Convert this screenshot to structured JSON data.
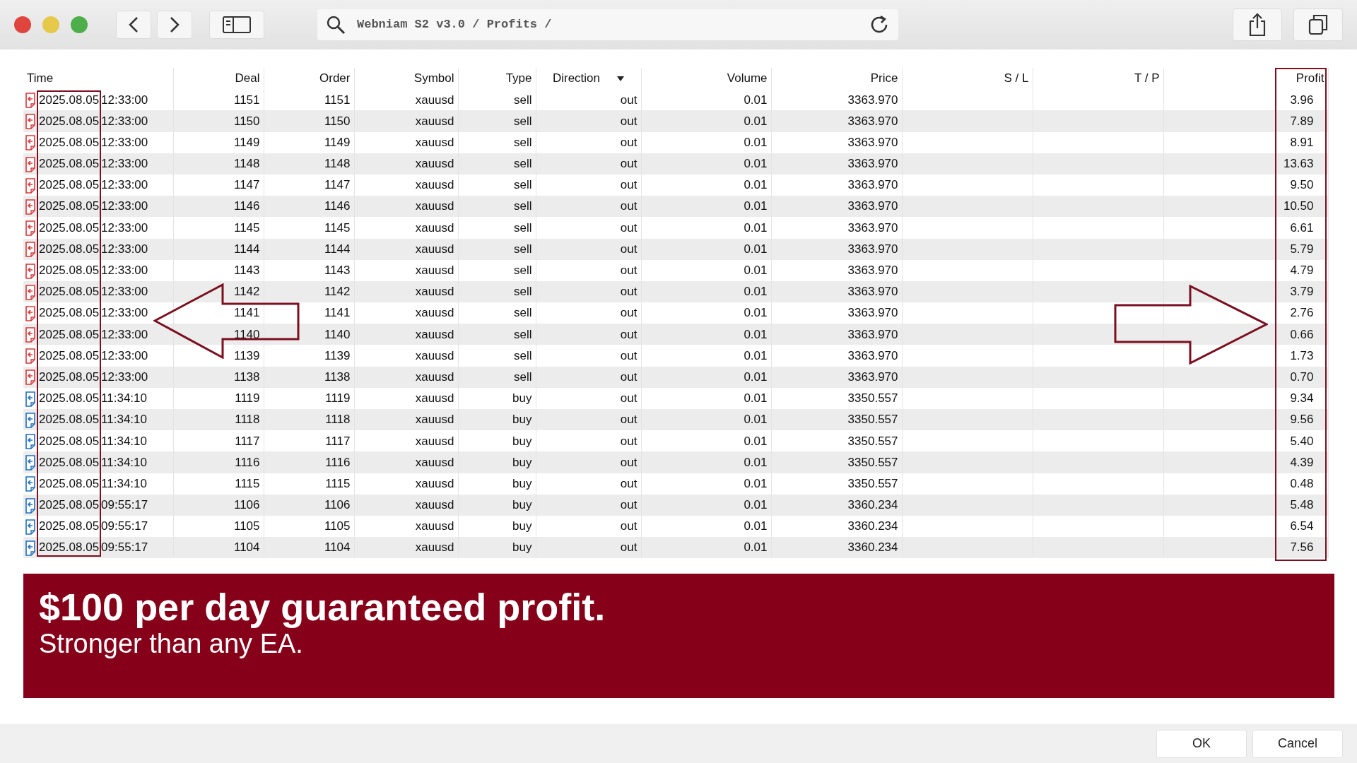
{
  "toolbar": {
    "address": "Webniam S2 v3.0 / Profits /"
  },
  "table": {
    "columns": [
      {
        "label": "Time"
      },
      {
        "label": "Deal"
      },
      {
        "label": "Order"
      },
      {
        "label": "Symbol"
      },
      {
        "label": "Type"
      },
      {
        "label": "Direction",
        "sorted": true
      },
      {
        "label": "Volume"
      },
      {
        "label": "Price"
      },
      {
        "label": "S / L"
      },
      {
        "label": "T / P"
      },
      {
        "label": "Profit"
      }
    ],
    "rows": [
      {
        "kind": "sell",
        "date": "2025.08.05",
        "time": "12:33:00",
        "deal": "1151",
        "order": "1151",
        "symbol": "xauusd",
        "type": "sell",
        "direction": "out",
        "volume": "0.01",
        "price": "3363.970",
        "profit": "3.96"
      },
      {
        "kind": "sell",
        "date": "2025.08.05",
        "time": "12:33:00",
        "deal": "1150",
        "order": "1150",
        "symbol": "xauusd",
        "type": "sell",
        "direction": "out",
        "volume": "0.01",
        "price": "3363.970",
        "profit": "7.89"
      },
      {
        "kind": "sell",
        "date": "2025.08.05",
        "time": "12:33:00",
        "deal": "1149",
        "order": "1149",
        "symbol": "xauusd",
        "type": "sell",
        "direction": "out",
        "volume": "0.01",
        "price": "3363.970",
        "profit": "8.91"
      },
      {
        "kind": "sell",
        "date": "2025.08.05",
        "time": "12:33:00",
        "deal": "1148",
        "order": "1148",
        "symbol": "xauusd",
        "type": "sell",
        "direction": "out",
        "volume": "0.01",
        "price": "3363.970",
        "profit": "13.63"
      },
      {
        "kind": "sell",
        "date": "2025.08.05",
        "time": "12:33:00",
        "deal": "1147",
        "order": "1147",
        "symbol": "xauusd",
        "type": "sell",
        "direction": "out",
        "volume": "0.01",
        "price": "3363.970",
        "profit": "9.50"
      },
      {
        "kind": "sell",
        "date": "2025.08.05",
        "time": "12:33:00",
        "deal": "1146",
        "order": "1146",
        "symbol": "xauusd",
        "type": "sell",
        "direction": "out",
        "volume": "0.01",
        "price": "3363.970",
        "profit": "10.50"
      },
      {
        "kind": "sell",
        "date": "2025.08.05",
        "time": "12:33:00",
        "deal": "1145",
        "order": "1145",
        "symbol": "xauusd",
        "type": "sell",
        "direction": "out",
        "volume": "0.01",
        "price": "3363.970",
        "profit": "6.61"
      },
      {
        "kind": "sell",
        "date": "2025.08.05",
        "time": "12:33:00",
        "deal": "1144",
        "order": "1144",
        "symbol": "xauusd",
        "type": "sell",
        "direction": "out",
        "volume": "0.01",
        "price": "3363.970",
        "profit": "5.79"
      },
      {
        "kind": "sell",
        "date": "2025.08.05",
        "time": "12:33:00",
        "deal": "1143",
        "order": "1143",
        "symbol": "xauusd",
        "type": "sell",
        "direction": "out",
        "volume": "0.01",
        "price": "3363.970",
        "profit": "4.79"
      },
      {
        "kind": "sell",
        "date": "2025.08.05",
        "time": "12:33:00",
        "deal": "1142",
        "order": "1142",
        "symbol": "xauusd",
        "type": "sell",
        "direction": "out",
        "volume": "0.01",
        "price": "3363.970",
        "profit": "3.79"
      },
      {
        "kind": "sell",
        "date": "2025.08.05",
        "time": "12:33:00",
        "deal": "1141",
        "order": "1141",
        "symbol": "xauusd",
        "type": "sell",
        "direction": "out",
        "volume": "0.01",
        "price": "3363.970",
        "profit": "2.76"
      },
      {
        "kind": "sell",
        "date": "2025.08.05",
        "time": "12:33:00",
        "deal": "1140",
        "order": "1140",
        "symbol": "xauusd",
        "type": "sell",
        "direction": "out",
        "volume": "0.01",
        "price": "3363.970",
        "profit": "0.66"
      },
      {
        "kind": "sell",
        "date": "2025.08.05",
        "time": "12:33:00",
        "deal": "1139",
        "order": "1139",
        "symbol": "xauusd",
        "type": "sell",
        "direction": "out",
        "volume": "0.01",
        "price": "3363.970",
        "profit": "1.73"
      },
      {
        "kind": "sell",
        "date": "2025.08.05",
        "time": "12:33:00",
        "deal": "1138",
        "order": "1138",
        "symbol": "xauusd",
        "type": "sell",
        "direction": "out",
        "volume": "0.01",
        "price": "3363.970",
        "profit": "0.70"
      },
      {
        "kind": "buy",
        "date": "2025.08.05",
        "time": "11:34:10",
        "deal": "1119",
        "order": "1119",
        "symbol": "xauusd",
        "type": "buy",
        "direction": "out",
        "volume": "0.01",
        "price": "3350.557",
        "profit": "9.34"
      },
      {
        "kind": "buy",
        "date": "2025.08.05",
        "time": "11:34:10",
        "deal": "1118",
        "order": "1118",
        "symbol": "xauusd",
        "type": "buy",
        "direction": "out",
        "volume": "0.01",
        "price": "3350.557",
        "profit": "9.56"
      },
      {
        "kind": "buy",
        "date": "2025.08.05",
        "time": "11:34:10",
        "deal": "1117",
        "order": "1117",
        "symbol": "xauusd",
        "type": "buy",
        "direction": "out",
        "volume": "0.01",
        "price": "3350.557",
        "profit": "5.40"
      },
      {
        "kind": "buy",
        "date": "2025.08.05",
        "time": "11:34:10",
        "deal": "1116",
        "order": "1116",
        "symbol": "xauusd",
        "type": "buy",
        "direction": "out",
        "volume": "0.01",
        "price": "3350.557",
        "profit": "4.39"
      },
      {
        "kind": "buy",
        "date": "2025.08.05",
        "time": "11:34:10",
        "deal": "1115",
        "order": "1115",
        "symbol": "xauusd",
        "type": "buy",
        "direction": "out",
        "volume": "0.01",
        "price": "3350.557",
        "profit": "0.48"
      },
      {
        "kind": "buy",
        "date": "2025.08.05",
        "time": "09:55:17",
        "deal": "1106",
        "order": "1106",
        "symbol": "xauusd",
        "type": "buy",
        "direction": "out",
        "volume": "0.01",
        "price": "3360.234",
        "profit": "5.48"
      },
      {
        "kind": "buy",
        "date": "2025.08.05",
        "time": "09:55:17",
        "deal": "1105",
        "order": "1105",
        "symbol": "xauusd",
        "type": "buy",
        "direction": "out",
        "volume": "0.01",
        "price": "3360.234",
        "profit": "6.54"
      },
      {
        "kind": "buy",
        "date": "2025.08.05",
        "time": "09:55:17",
        "deal": "1104",
        "order": "1104",
        "symbol": "xauusd",
        "type": "buy",
        "direction": "out",
        "volume": "0.01",
        "price": "3360.234",
        "profit": "7.56"
      }
    ]
  },
  "banner": {
    "headline": "$100 per day guaranteed profit.",
    "subline": "Stronger than any EA."
  },
  "buttons": [
    {
      "label": "OK"
    },
    {
      "label": "Cancel"
    }
  ]
}
